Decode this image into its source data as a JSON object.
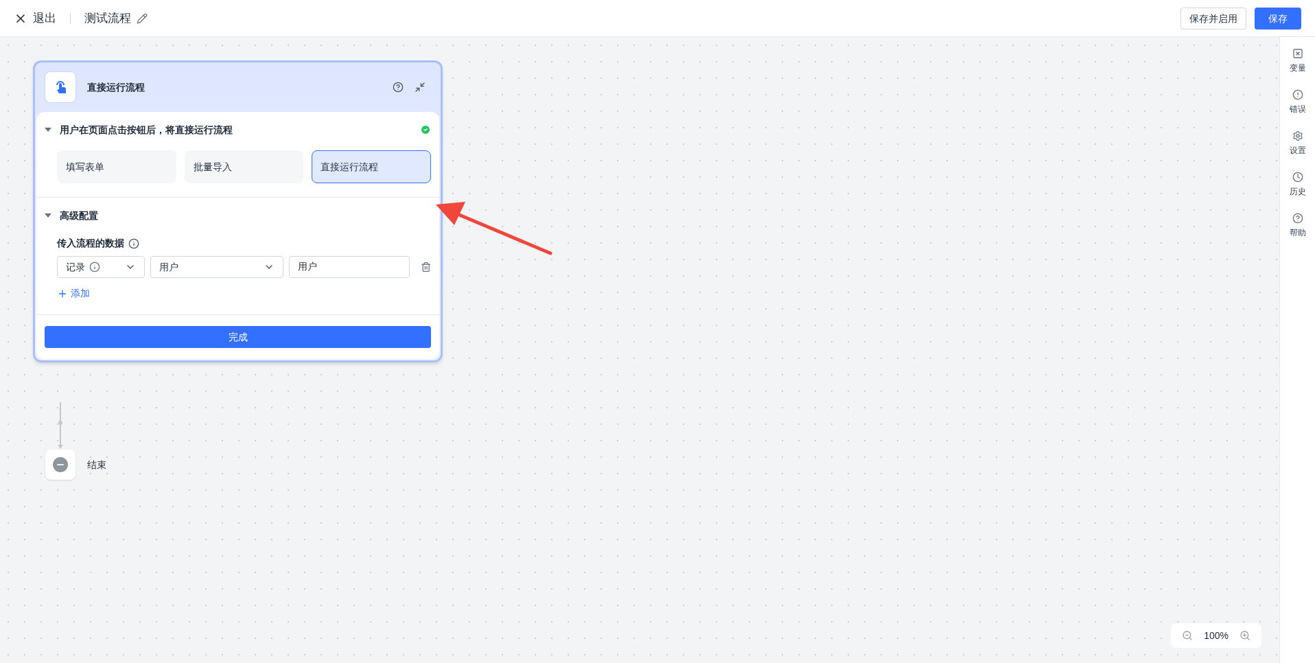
{
  "topbar": {
    "exit": "退出",
    "title": "测试流程",
    "buttons": [
      {
        "label": "保存并启用",
        "kind": "secondary"
      },
      {
        "label": "保存",
        "kind": "primary"
      }
    ]
  },
  "trigger_node": {
    "title": "直接运行流程",
    "section_1": {
      "title": "用户在页面点击按钮后，将直接运行流程",
      "expanded": true,
      "valid": true,
      "options": [
        {
          "label": "填写表单",
          "selected": false
        },
        {
          "label": "批量导入",
          "selected": false
        },
        {
          "label": "直接运行流程",
          "selected": true
        }
      ]
    },
    "section_2": {
      "title": "高级配置",
      "expanded": true,
      "field_label": "传入流程的数据",
      "row": {
        "type_select": "记录",
        "source_select": "用户",
        "value": "用户"
      },
      "add": "添加"
    },
    "done_button": "完成"
  },
  "end_node": {
    "label": "结束"
  },
  "right_panel": [
    {
      "label": "变量",
      "kind": "variable"
    },
    {
      "label": "错误",
      "kind": "error"
    },
    {
      "label": "设置",
      "kind": "settings"
    },
    {
      "label": "历史",
      "kind": "history"
    },
    {
      "label": "帮助",
      "kind": "help"
    }
  ],
  "zoom": {
    "value": "100%"
  }
}
